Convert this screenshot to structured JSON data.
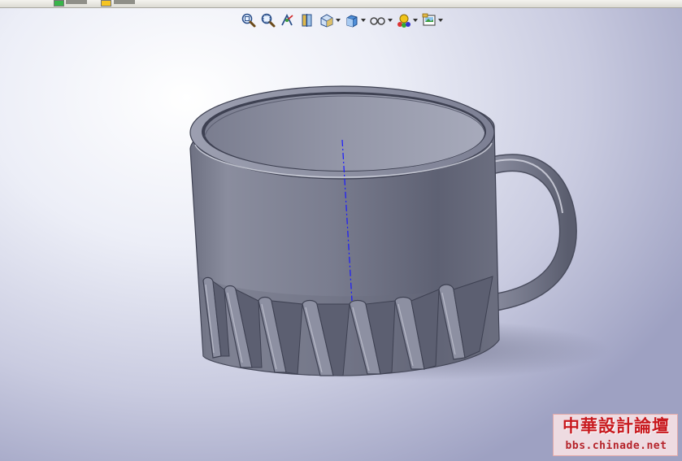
{
  "toolbar": {
    "tools": [
      {
        "icon": "zoom-to-fit-icon",
        "has_menu": false
      },
      {
        "icon": "zoom-to-area-icon",
        "has_menu": false
      },
      {
        "icon": "previous-view-icon",
        "has_menu": false
      },
      {
        "icon": "section-view-icon",
        "has_menu": false
      },
      {
        "icon": "view-orientation-icon",
        "has_menu": true
      },
      {
        "icon": "display-style-icon",
        "has_menu": true
      },
      {
        "icon": "hide-show-items-icon",
        "has_menu": true
      },
      {
        "icon": "edit-appearance-icon",
        "has_menu": true
      },
      {
        "icon": "apply-scene-icon",
        "has_menu": true
      }
    ]
  },
  "model": {
    "object": "mug-3d-model",
    "body_color": "#777a8a",
    "axis_color": "#1a1aff"
  },
  "watermark": {
    "title": "中華設計論壇",
    "url": "bbs.chinade.net",
    "color": "#c8191e"
  }
}
